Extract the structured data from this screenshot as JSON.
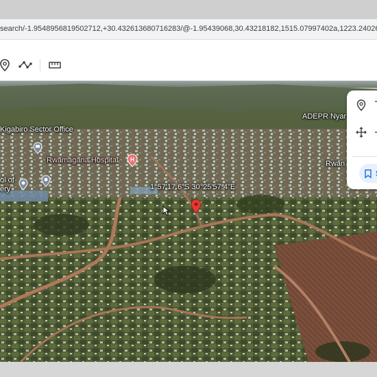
{
  "browser": {
    "url": "search/-1.9548956819502712,+30.432613680716283/@-1.95439068,30.43218182,1515.07997402a,1223.24026757d,35"
  },
  "toolbar": {
    "tools": [
      {
        "name": "placemark-icon"
      },
      {
        "name": "path-icon"
      },
      {
        "name": "ruler-icon"
      }
    ]
  },
  "map": {
    "labels": {
      "kigabiro": "Kigabiro Sector Office",
      "adepr": "ADEPR Nyar",
      "hospital": "Rwamagana Hospital",
      "rwa": "Rwan",
      "school_line1": "ol of",
      "school_line2": "ery",
      "coordinates": "1°57'17.6\"S 30°25'57.4\"E"
    },
    "colors": {
      "pin": "#e53935",
      "hospital": "#e57373"
    }
  },
  "panel": {
    "save_label": "S",
    "buttons": [
      {
        "name": "placemark-icon"
      },
      {
        "name": "move-icon"
      },
      {
        "name": "bookmark-icon"
      }
    ]
  }
}
